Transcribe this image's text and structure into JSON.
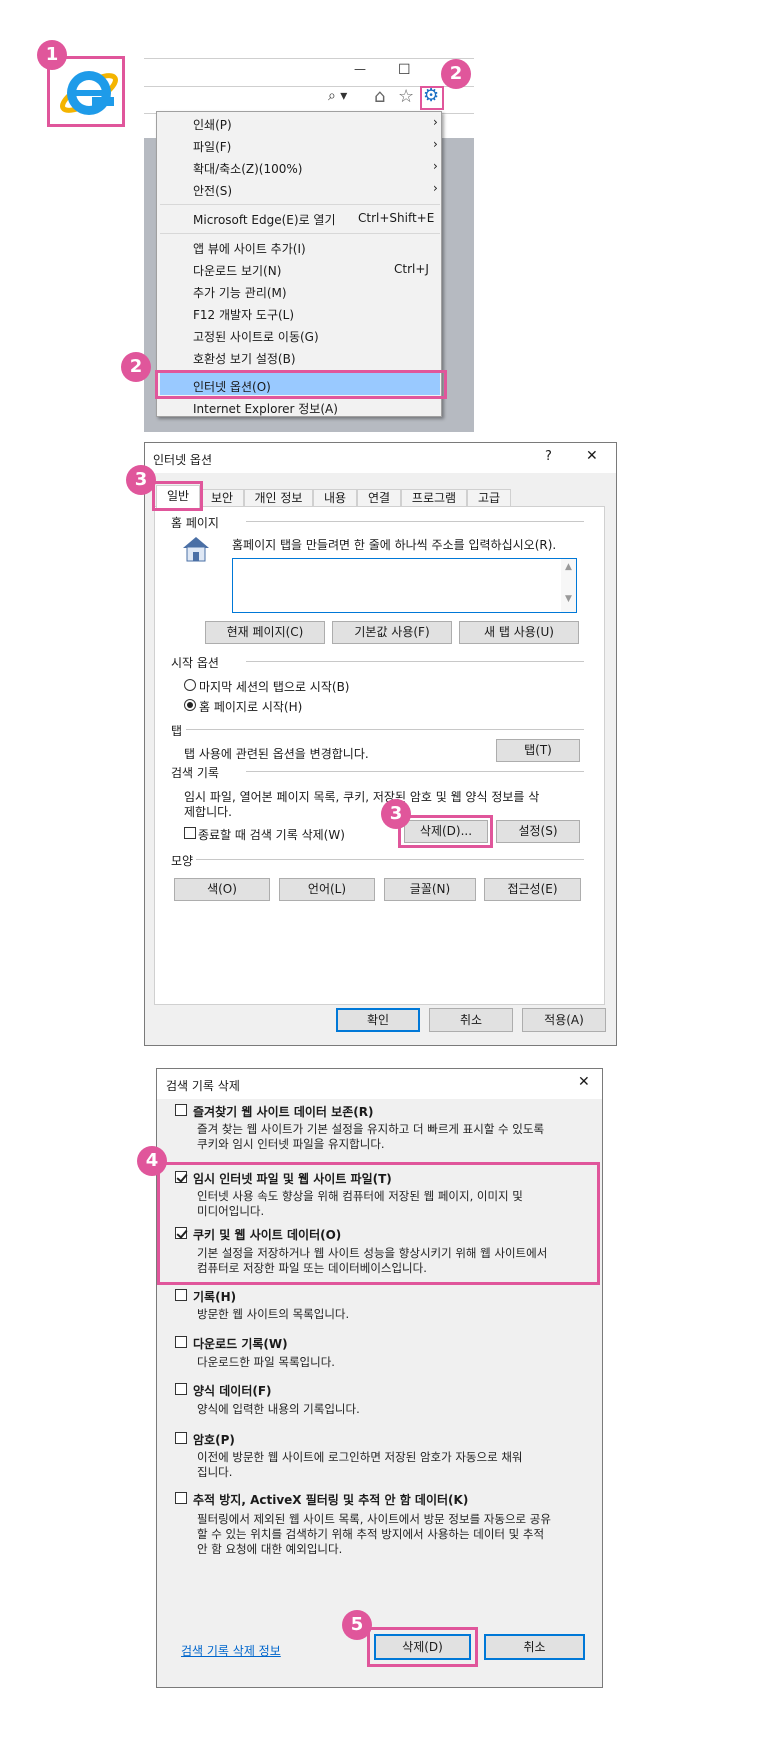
{
  "badges": [
    "1",
    "2",
    "2",
    "3",
    "3",
    "4",
    "5"
  ],
  "browser": {
    "window_minimize": "—",
    "window_maximize": "☐",
    "search_glyph": "⌕ ▾",
    "home_glyph": "⌂",
    "star_glyph": "☆",
    "gear_glyph": "⚙"
  },
  "tools_menu": {
    "items": [
      {
        "label": "인쇄(P)",
        "arrow": "›"
      },
      {
        "label": "파일(F)",
        "arrow": "›"
      },
      {
        "label": "확대/축소(Z)(100%)",
        "arrow": "›"
      },
      {
        "label": "안전(S)",
        "arrow": "›"
      },
      {
        "label": "Microsoft Edge(E)로 열기",
        "shortcut": "Ctrl+Shift+E"
      },
      {
        "label": "앱 뷰에 사이트 추가(I)"
      },
      {
        "label": "다운로드 보기(N)",
        "shortcut": "Ctrl+J"
      },
      {
        "label": "추가 기능 관리(M)"
      },
      {
        "label": "F12 개발자 도구(L)"
      },
      {
        "label": "고정된 사이트로 이동(G)"
      },
      {
        "label": "호환성 보기 설정(B)"
      },
      {
        "label": "인터넷 옵션(O)"
      },
      {
        "label": "Internet Explorer 정보(A)"
      }
    ]
  },
  "internet_options": {
    "title": "인터넷 옵션",
    "help": "?",
    "close": "✕",
    "tabs": [
      "일반",
      "보안",
      "개인 정보",
      "내용",
      "연결",
      "프로그램",
      "고급"
    ],
    "home_page": {
      "header": "홈 페이지",
      "description": "홈페이지 탭을 만들려면 한 줄에 하나씩 주소를 입력하십시오(R).",
      "url_value": "",
      "buttons": [
        "현재 페이지(C)",
        "기본값 사용(F)",
        "새 탭 사용(U)"
      ]
    },
    "startup": {
      "header": "시작 옵션",
      "options": [
        "마지막 세션의 탭으로 시작(B)",
        "홈 페이지로 시작(H)"
      ],
      "selected_index": 1
    },
    "tabs_section": {
      "header": "탭",
      "description": "탭 사용에 관련된 옵션을 변경합니다.",
      "button": "탭(T)"
    },
    "browsing_history": {
      "header": "검색 기록",
      "description_line1": "임시 파일, 열어본 페이지 목록, 쿠키, 저장된 암호 및 웹 양식 정보를 삭",
      "description_line2": "제합니다.",
      "delete_on_exit": "종료할 때 검색 기록 삭제(W)",
      "delete_button": "삭제(D)...",
      "settings_button": "설정(S)"
    },
    "appearance": {
      "header": "모양",
      "buttons": [
        "색(O)",
        "언어(L)",
        "글꼴(N)",
        "접근성(E)"
      ]
    },
    "footer": [
      "확인",
      "취소",
      "적용(A)"
    ]
  },
  "delete_history": {
    "title": "검색 기록 삭제",
    "close": "✕",
    "options": [
      {
        "title": "즐겨찾기 웹 사이트 데이터 보존(R)",
        "checked": false,
        "desc": [
          "즐겨 찾는 웹 사이트가 기본 설정을 유지하고 더 빠르게 표시할 수 있도록",
          "쿠키와 임시 인터넷 파일을 유지합니다."
        ]
      },
      {
        "title": "임시 인터넷 파일 및 웹 사이트 파일(T)",
        "checked": true,
        "desc": [
          "인터넷 사용 속도 향상을 위해 컴퓨터에 저장된 웹 페이지, 이미지 및",
          "미디어입니다."
        ]
      },
      {
        "title": "쿠키 및 웹 사이트 데이터(O)",
        "checked": true,
        "desc": [
          "기본 설정을 저장하거나 웹 사이트 성능을 향상시키기 위해 웹 사이트에서",
          "컴퓨터로 저장한 파일 또는 데이터베이스입니다."
        ]
      },
      {
        "title": "기록(H)",
        "checked": false,
        "desc": [
          "방문한 웹 사이트의 목록입니다."
        ]
      },
      {
        "title": "다운로드 기록(W)",
        "checked": false,
        "desc": [
          "다운로드한 파일 목록입니다."
        ]
      },
      {
        "title": "양식 데이터(F)",
        "checked": false,
        "desc": [
          "양식에 입력한 내용의 기록입니다."
        ]
      },
      {
        "title": "암호(P)",
        "checked": false,
        "desc": [
          "이전에 방문한 웹 사이트에 로그인하면 저장된 암호가 자동으로 채워",
          "집니다."
        ]
      },
      {
        "title": "추적 방지, ActiveX 필터링 및 추적 안 함 데이터(K)",
        "checked": false,
        "desc": [
          "필터링에서 제외된 웹 사이트 목록, 사이트에서 방문 정보를 자동으로 공유",
          "할 수 있는 위치를 검색하기 위해 추적 방지에서 사용하는 데이터 및 추적",
          "안 함 요청에 대한 예외입니다."
        ]
      }
    ],
    "info_link": "검색 기록 삭제 정보",
    "delete_button": "삭제(D)",
    "cancel_button": "취소"
  },
  "colors": {
    "accent_pink": "#e0569b",
    "selected_blue": "#99c9ff",
    "windows_blue": "#0078d7"
  }
}
